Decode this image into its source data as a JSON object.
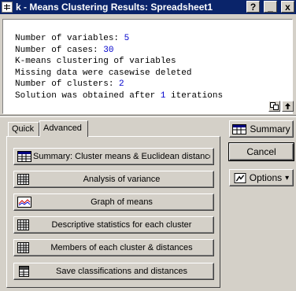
{
  "window": {
    "app_icon": "spreadsheet-icon",
    "title": "k - Means Clustering Results: Spreadsheet1",
    "help_label": "?",
    "minimize_label": "_",
    "close_label": "x"
  },
  "output": {
    "lines": [
      {
        "text": "Number of variables: ",
        "value": "5"
      },
      {
        "text": "Number of cases: ",
        "value": "30"
      },
      {
        "text": "K-means clustering of variables",
        "value": ""
      },
      {
        "text": "Missing data were casewise deleted",
        "value": ""
      },
      {
        "text": "Number of clusters: ",
        "value": "2"
      },
      {
        "text": "Solution was obtained after ",
        "value": "1",
        "suffix": " iterations"
      }
    ],
    "value_color": "#0000cc",
    "copy_icon": "copy-icon",
    "expand_icon": "up-arrow-icon"
  },
  "tabs": [
    {
      "label": "Quick",
      "active": false
    },
    {
      "label": "Advanced",
      "active": true
    }
  ],
  "commands": [
    {
      "label": "Summary: Cluster means & Euclidean distances",
      "icon": "summary-table-icon"
    },
    {
      "label": "Analysis of variance",
      "icon": "grid-table-icon"
    },
    {
      "label": "Graph of means",
      "icon": "line-graph-icon"
    },
    {
      "label": "Descriptive statistics for each cluster",
      "icon": "grid-table-icon"
    },
    {
      "label": "Members of each cluster & distances",
      "icon": "grid-table-icon"
    },
    {
      "label": "Save classifications and distances",
      "icon": "save-data-icon"
    }
  ],
  "side_buttons": {
    "summary_label": "Summary",
    "cancel_label": "Cancel",
    "options_label": "Options",
    "options_arrow": "▾"
  },
  "colors": {
    "titlebar": "#0a246a",
    "face": "#d4d0c8"
  }
}
